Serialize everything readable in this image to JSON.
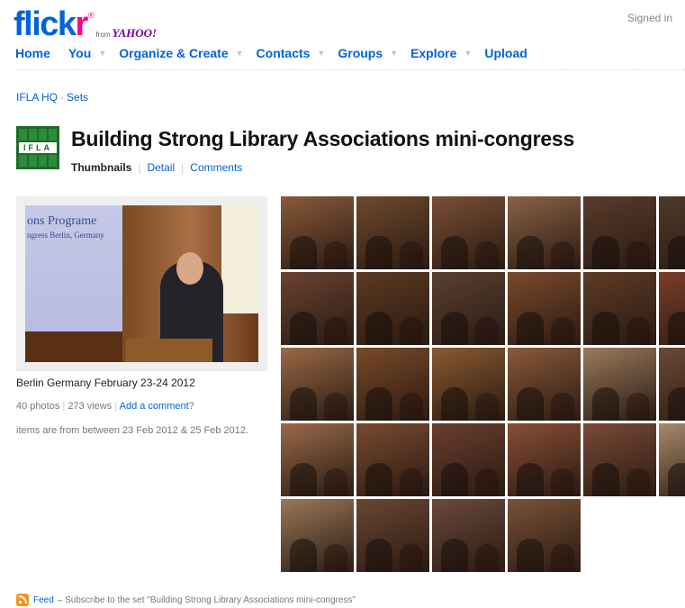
{
  "brand": {
    "flick": "flick",
    "r": "r",
    "reg": "®",
    "from": "from",
    "yahoo": "YAHOO!"
  },
  "signed_in": "Signed in",
  "nav": {
    "home": "Home",
    "you": "You",
    "organize": "Organize & Create",
    "contacts": "Contacts",
    "groups": "Groups",
    "explore": "Explore",
    "upload": "Upload",
    "caret": "▼"
  },
  "breadcrumb": {
    "owner": "IFLA HQ",
    "sep": "·",
    "sets": "Sets"
  },
  "set_icon_text": "IFLA",
  "set": {
    "title": "Building Strong Library Associations mini-congress",
    "view_thumbnails": "Thumbnails",
    "view_detail": "Detail",
    "view_comments": "Comments",
    "view_sep": "|"
  },
  "cover": {
    "screen_line1": "ons Programe",
    "screen_line2": "ngress Berlin, Germany"
  },
  "description": "Berlin Germany February 23-24 2012",
  "stats": {
    "photos": "40 photos",
    "sep": "|",
    "views": "273 views",
    "add_comment": "Add a comment",
    "q": "?"
  },
  "dates": "items are from between 23 Feb 2012 & 25 Feb 2012.",
  "thumbnails": [
    {
      "color": "#8a5a3a"
    },
    {
      "color": "#6e4a2c"
    },
    {
      "color": "#7a4f36"
    },
    {
      "color": "#8b6245"
    },
    {
      "color": "#5a3b2a"
    },
    {
      "color": "#4d3a2a"
    },
    {
      "color": "#6a4232"
    },
    {
      "color": "#5c3a20"
    },
    {
      "color": "#5a4032"
    },
    {
      "color": "#7b4a2c"
    },
    {
      "color": "#5e3b26"
    },
    {
      "color": "#7a3e2a"
    },
    {
      "color": "#9a6a46"
    },
    {
      "color": "#7a4a28"
    },
    {
      "color": "#8a5a30"
    },
    {
      "color": "#8a5a3a"
    },
    {
      "color": "#9a7a5c"
    },
    {
      "color": "#6a4a36"
    },
    {
      "color": "#9a6a4a"
    },
    {
      "color": "#7a4a30"
    },
    {
      "color": "#6a3e2e"
    },
    {
      "color": "#8a4e36"
    },
    {
      "color": "#7a4a36"
    },
    {
      "color": "#a88a6c"
    },
    {
      "color": "#9a7858"
    },
    {
      "color": "#6a4632"
    },
    {
      "color": "#6a4a3c"
    },
    {
      "color": "#7a5238"
    }
  ],
  "footer": {
    "feed": "Feed",
    "text": "– Subscribe to the set \"Building Strong Library Associations mini-congress\""
  },
  "colors": {
    "link": "#0063dc",
    "brand_pink": "#ff0084",
    "ifla_green": "#1e6a2a"
  }
}
